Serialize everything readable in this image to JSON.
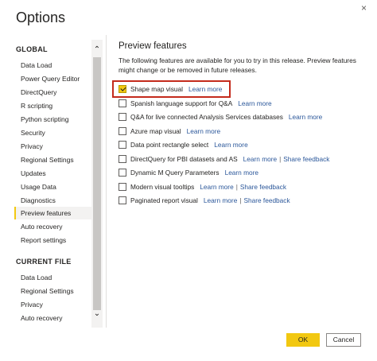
{
  "window": {
    "title": "Options",
    "close_glyph": "×"
  },
  "sidebar": {
    "global_header": "GLOBAL",
    "global_items": [
      {
        "label": "Data Load"
      },
      {
        "label": "Power Query Editor"
      },
      {
        "label": "DirectQuery"
      },
      {
        "label": "R scripting"
      },
      {
        "label": "Python scripting"
      },
      {
        "label": "Security"
      },
      {
        "label": "Privacy"
      },
      {
        "label": "Regional Settings"
      },
      {
        "label": "Updates"
      },
      {
        "label": "Usage Data"
      },
      {
        "label": "Diagnostics"
      },
      {
        "label": "Preview features",
        "active": true
      },
      {
        "label": "Auto recovery"
      },
      {
        "label": "Report settings"
      }
    ],
    "current_header": "CURRENT FILE",
    "current_items": [
      {
        "label": "Data Load"
      },
      {
        "label": "Regional Settings"
      },
      {
        "label": "Privacy"
      },
      {
        "label": "Auto recovery"
      }
    ],
    "scroll_up_glyph": "⌃",
    "scroll_down_glyph": "⌄"
  },
  "main": {
    "title": "Preview features",
    "description": "The following features are available for you to try in this release. Preview features might change or be removed in future releases.",
    "features": [
      {
        "label": "Shape map visual",
        "checked": true,
        "learn_more": "Learn more"
      },
      {
        "label": "Spanish language support for Q&A",
        "checked": false,
        "learn_more": "Learn more"
      },
      {
        "label": "Q&A for live connected Analysis Services databases",
        "checked": false,
        "learn_more": "Learn more"
      },
      {
        "label": "Azure map visual",
        "checked": false,
        "learn_more": "Learn more"
      },
      {
        "label": "Data point rectangle select",
        "checked": false,
        "learn_more": "Learn more"
      },
      {
        "label": "DirectQuery for PBI datasets and AS",
        "checked": false,
        "learn_more": "Learn more",
        "share_feedback": "Share feedback"
      },
      {
        "label": "Dynamic M Query Parameters",
        "checked": false,
        "learn_more": "Learn more"
      },
      {
        "label": "Modern visual tooltips",
        "checked": false,
        "learn_more": "Learn more",
        "share_feedback": "Share feedback"
      },
      {
        "label": "Paginated report visual",
        "checked": false,
        "learn_more": "Learn more",
        "share_feedback": "Share feedback"
      }
    ]
  },
  "footer": {
    "ok_label": "OK",
    "cancel_label": "Cancel"
  },
  "colors": {
    "accent": "#f2c811",
    "link": "#2b579a",
    "highlight": "#c42b1c"
  }
}
